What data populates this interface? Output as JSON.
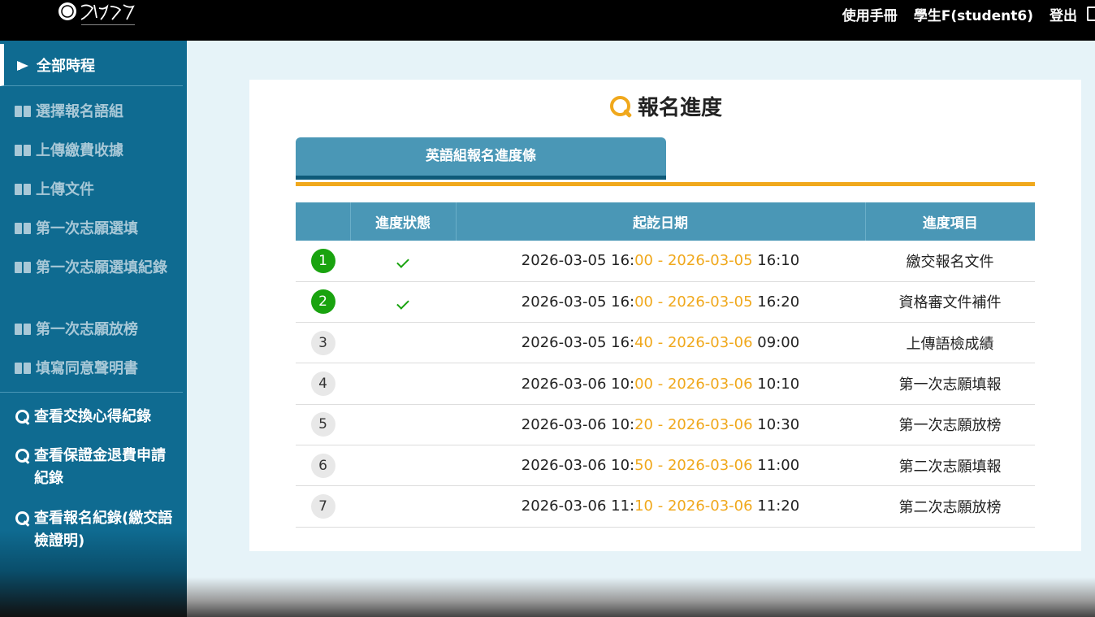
{
  "header": {
    "logo_name": "政治大學",
    "manual": "使用手冊",
    "user": "學生F(student6)",
    "logout": "登出"
  },
  "sidebar": {
    "active": "全部時程",
    "items": [
      "選擇報名語組",
      "上傳繳費收據",
      "上傳文件",
      "第一次志願選填",
      "第一次志願選填紀錄",
      "第一次志願放榜",
      "填寫同意聲明書"
    ],
    "links": [
      "查看交換心得紀錄",
      "查看保證金退費申請紀錄",
      "查看報名紀錄(繳交語檢證明)"
    ]
  },
  "main": {
    "title": "報名進度",
    "tab": "英語組報名進度條",
    "columns": [
      "",
      "進度狀態",
      "起訖日期",
      "進度項目"
    ],
    "rows": [
      {
        "no": "1",
        "done": true,
        "start_date": "2026-03-05 16:",
        "start_min": "00",
        "sep": " - ",
        "end_date": "2026-03-05",
        "end_time": " 16:10",
        "item": "繳交報名文件"
      },
      {
        "no": "2",
        "done": true,
        "start_date": "2026-03-05 16:",
        "start_min": "00",
        "sep": " - ",
        "end_date": "2026-03-05",
        "end_time": " 16:20",
        "item": "資格審文件補件"
      },
      {
        "no": "3",
        "done": false,
        "start_date": "2026-03-05 16:",
        "start_min": "40",
        "sep": " - ",
        "end_date": "2026-03-06",
        "end_time": " 09:00",
        "item": "上傳語檢成績"
      },
      {
        "no": "4",
        "done": false,
        "start_date": "2026-03-06 10:",
        "start_min": "00",
        "sep": " - ",
        "end_date": "2026-03-06",
        "end_time": " 10:10",
        "item": "第一次志願填報"
      },
      {
        "no": "5",
        "done": false,
        "start_date": "2026-03-06 10:",
        "start_min": "20",
        "sep": " - ",
        "end_date": "2026-03-06",
        "end_time": " 10:30",
        "item": "第一次志願放榜"
      },
      {
        "no": "6",
        "done": false,
        "start_date": "2026-03-06 10:",
        "start_min": "50",
        "sep": " - ",
        "end_date": "2026-03-06",
        "end_time": " 11:00",
        "item": "第二次志願填報"
      },
      {
        "no": "7",
        "done": false,
        "start_date": "2026-03-06 11:",
        "start_min": "10",
        "sep": " - ",
        "end_date": "2026-03-06",
        "end_time": " 11:20",
        "item": "第二次志願放榜"
      }
    ]
  },
  "colors": {
    "topbar": "#000000",
    "sidebar": "#0f6b91",
    "accent": "#f0a81c",
    "header_blue": "#4a97b6",
    "done_green": "#19a30f"
  }
}
